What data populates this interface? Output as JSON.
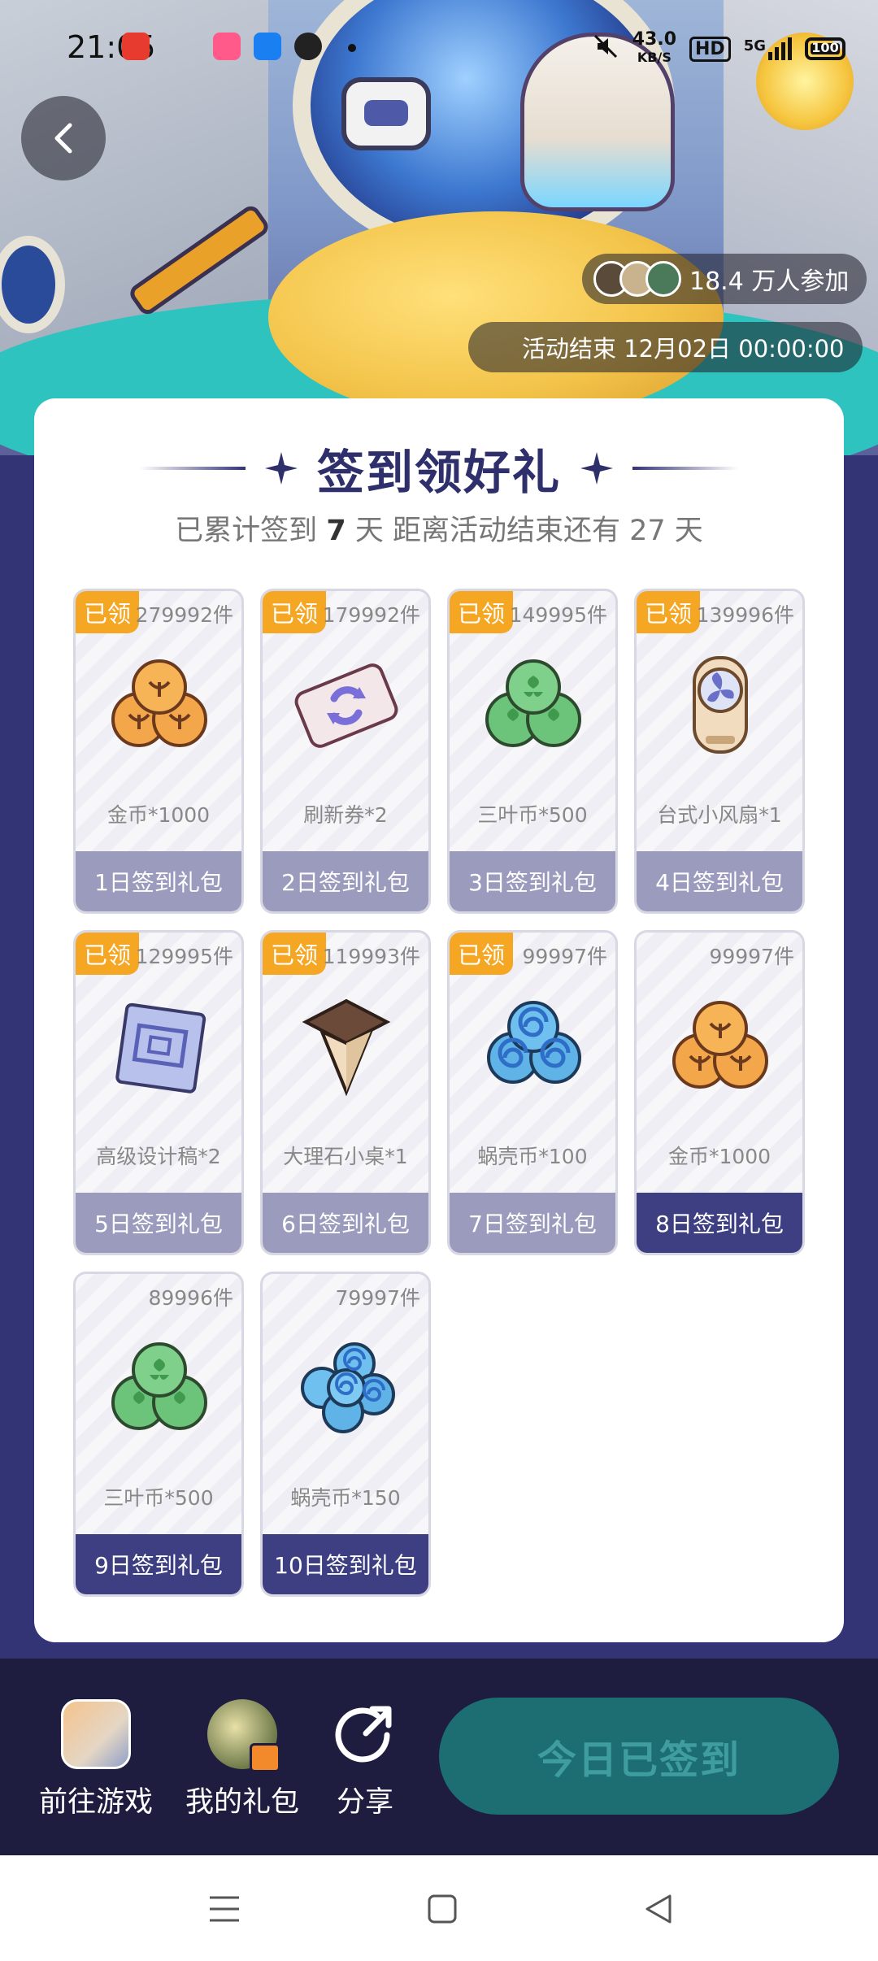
{
  "status_bar": {
    "time": "21:05",
    "net_speed": "43.0",
    "net_unit": "KB/S",
    "hd": "HD",
    "signal": "5G",
    "battery": "100"
  },
  "banner": {
    "participants": "18.4 万人参加",
    "end_time": "活动结束 12月02日 00:00:00"
  },
  "card": {
    "title": "签到领好礼",
    "subtitle_prefix": "已累计签到",
    "signed_days": "7",
    "subtitle_mid": "天  距离活动结束还有",
    "remaining_days": "27",
    "subtitle_suffix": "天"
  },
  "gifts": [
    {
      "claimed": "已领",
      "stock": "279992件",
      "name": "金币*1000",
      "day": "1日签到礼包",
      "icon": "gold-coin-icon"
    },
    {
      "claimed": "已领",
      "stock": "179992件",
      "name": "刷新券*2",
      "day": "2日签到礼包",
      "icon": "refresh-ticket-icon"
    },
    {
      "claimed": "已领",
      "stock": "149995件",
      "name": "三叶币*500",
      "day": "3日签到礼包",
      "icon": "clover-coin-icon"
    },
    {
      "claimed": "已领",
      "stock": "139996件",
      "name": "台式小风扇*1",
      "day": "4日签到礼包",
      "icon": "desk-fan-icon"
    },
    {
      "claimed": "已领",
      "stock": "129995件",
      "name": "高级设计稿*2",
      "day": "5日签到礼包",
      "icon": "blueprint-icon"
    },
    {
      "claimed": "已领",
      "stock": "119993件",
      "name": "大理石小桌*1",
      "day": "6日签到礼包",
      "icon": "marble-table-icon"
    },
    {
      "claimed": "已领",
      "stock": "99997件",
      "name": "蜗壳币*100",
      "day": "7日签到礼包",
      "icon": "shell-coin-icon"
    },
    {
      "claimed": "",
      "stock": "99997件",
      "name": "金币*1000",
      "day": "8日签到礼包",
      "icon": "gold-coin-icon"
    },
    {
      "claimed": "",
      "stock": "89996件",
      "name": "三叶币*500",
      "day": "9日签到礼包",
      "icon": "clover-coin-icon"
    },
    {
      "claimed": "",
      "stock": "79997件",
      "name": "蜗壳币*150",
      "day": "10日签到礼包",
      "icon": "shell-coin-icon"
    }
  ],
  "bottom_bar": {
    "go_game": "前往游戏",
    "my_gifts": "我的礼包",
    "share": "分享",
    "sign_button": "今日已签到"
  },
  "colors": {
    "page_bg": "#333476",
    "claimed_badge": "#f5a623",
    "footer_claimed": "#9b9bbd",
    "footer_active": "#3e3f82",
    "sign_button_bg": "#1c6e72"
  }
}
